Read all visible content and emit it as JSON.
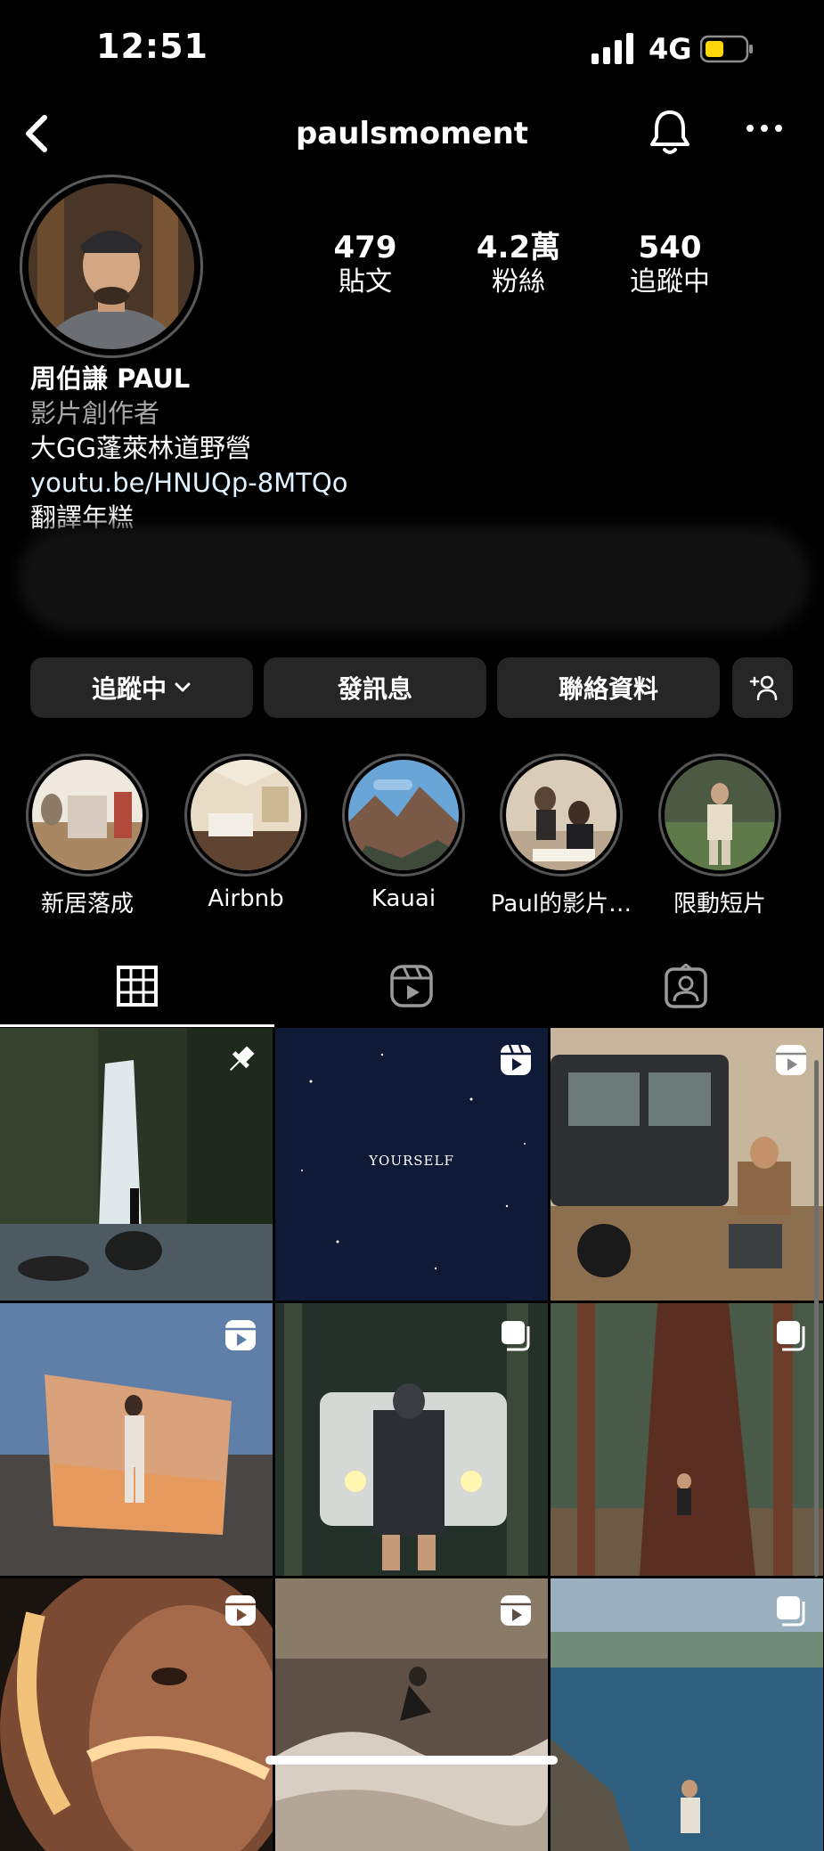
{
  "status": {
    "time": "12:51",
    "network": "4G",
    "battery_color": "#ffd60a"
  },
  "nav": {
    "username": "paulsmoment",
    "back_icon": "chevron-left-icon",
    "bell_icon": "bell-icon",
    "more_icon": "more-horizontal-icon"
  },
  "profile": {
    "stats": [
      {
        "value": "479",
        "label": "貼文"
      },
      {
        "value": "4.2萬",
        "label": "粉絲"
      },
      {
        "value": "540",
        "label": "追蹤中"
      }
    ],
    "name": "周伯謙 PAUL",
    "category": "影片創作者",
    "bio_line": "大GG蓬萊林道野營",
    "link": "youtu.be/HNUQp-8MTQo",
    "translate": "翻譯年糕"
  },
  "actions": {
    "following": "追蹤中",
    "message": "發訊息",
    "contact": "聯絡資料",
    "add_user_icon": "add-user-icon"
  },
  "highlights": [
    {
      "label": "新居落成"
    },
    {
      "label": "Airbnb"
    },
    {
      "label": "Kauai"
    },
    {
      "label": "Paul的影片…"
    },
    {
      "label": "限動短片"
    }
  ],
  "tabs": [
    "grid-icon",
    "reels-icon",
    "tagged-icon"
  ],
  "grid": [
    {
      "icon": "pin-icon"
    },
    {
      "icon": "reels-icon",
      "caption": "YOURSELF"
    },
    {
      "icon": "reels-icon"
    },
    {
      "icon": "reels-icon"
    },
    {
      "icon": "carousel-icon"
    },
    {
      "icon": "carousel-icon"
    },
    {
      "icon": "reels-icon"
    },
    {
      "icon": "reels-icon"
    },
    {
      "icon": "carousel-icon"
    }
  ]
}
